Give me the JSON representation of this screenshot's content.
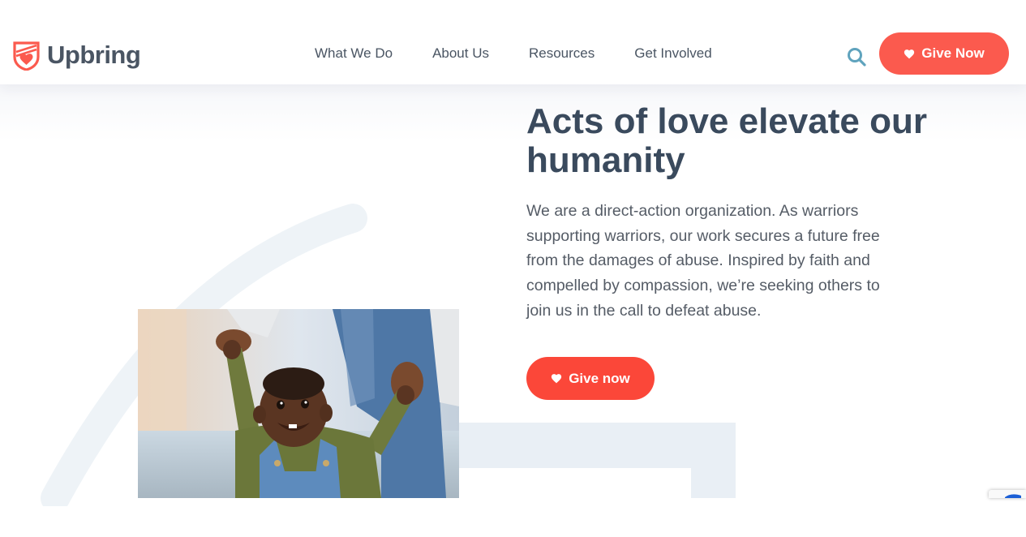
{
  "brand": {
    "name": "Upbring",
    "accent": "#fb5a4e",
    "text_color": "#4a5563"
  },
  "header": {
    "logo_icon": "shield-heart-icon",
    "nav": [
      {
        "label": "What We Do"
      },
      {
        "label": "About Us"
      },
      {
        "label": "Resources"
      },
      {
        "label": "Get Involved"
      }
    ],
    "search_icon": "search-icon",
    "give_button": {
      "label": "Give Now",
      "icon": "heart-icon"
    }
  },
  "hero": {
    "headline": "Acts of love elevate our humanity",
    "intro": "We are a direct-action organization. As warriors supporting warriors, our work secures a future free from the damages of abuse. Inspired by faith and compelled by compassion, we’re seeking others to join us in the call to defeat abuse.",
    "cta": {
      "label": "Give now",
      "icon": "heart-icon"
    },
    "image": "photo-of-smiling-toddler-learning-to-walk-holding-adult-hands",
    "cta_color": "#fb4739"
  },
  "widgets": {
    "recaptcha_icon": "recaptcha-icon"
  }
}
